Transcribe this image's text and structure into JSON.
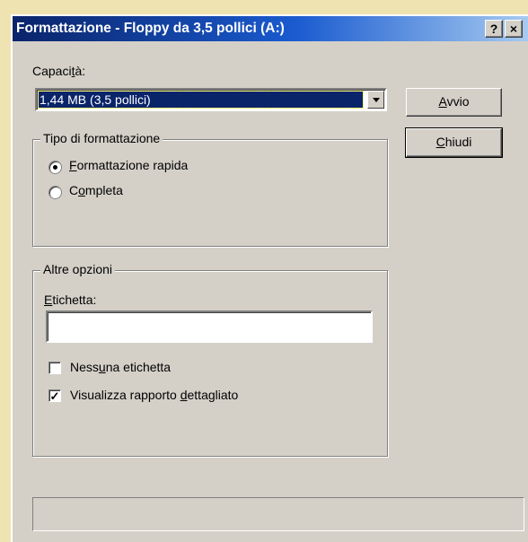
{
  "window": {
    "title": "Formattazione - Floppy da 3,5 pollici (A:)",
    "help_label": "?",
    "close_label": "×"
  },
  "capacity": {
    "label_pre": "Capaci",
    "label_mn": "t",
    "label_post": "à:",
    "selected": "1,44 MB (3,5 pollici)"
  },
  "buttons": {
    "start_mn": "A",
    "start_rest": "vvio",
    "close_mn": "C",
    "close_rest": "hiudi"
  },
  "format_type": {
    "legend": "Tipo di formattazione",
    "quick_mn": "F",
    "quick_rest": "ormattazione rapida",
    "full_pre": "C",
    "full_mn": "o",
    "full_rest": "mpleta",
    "selected": "quick"
  },
  "other_options": {
    "legend": "Altre opzioni",
    "label_mn": "E",
    "label_rest": "tichetta:",
    "label_value": "",
    "no_label_pre": "Ness",
    "no_label_mn": "u",
    "no_label_rest": "na etichetta",
    "no_label_checked": false,
    "detailed_pre": "Visualizza rapporto ",
    "detailed_mn": "d",
    "detailed_rest": "ettagliato",
    "detailed_checked": true,
    "check_mark": "✓"
  }
}
